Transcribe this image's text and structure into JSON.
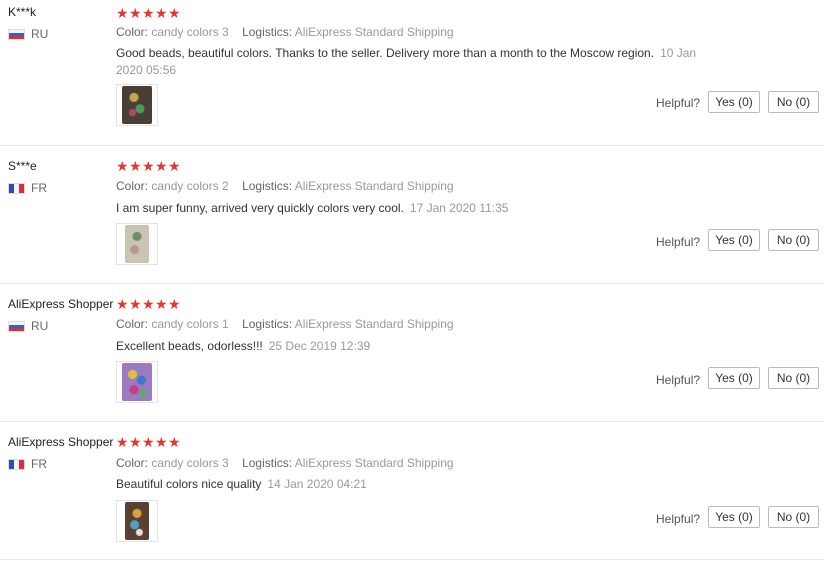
{
  "helpful_label": "Helpful?",
  "reviews": [
    {
      "user": "K***k",
      "country": "RU",
      "stars": 5,
      "color_label": "Color:",
      "color": "candy colors 3",
      "logistics_label": "Logistics:",
      "logistics": "AliExpress Standard Shipping",
      "text": "Good beads, beautiful colors. Thanks to the seller. Delivery more than a month to the Moscow region.",
      "date": "10 Jan 2020 05:56",
      "yes": "Yes (0)",
      "no": "No (0)"
    },
    {
      "user": "S***e",
      "country": "FR",
      "stars": 5,
      "color_label": "Color:",
      "color": "candy colors 2",
      "logistics_label": "Logistics:",
      "logistics": "AliExpress Standard Shipping",
      "text": "I am super funny, arrived very quickly colors very cool.",
      "date": "17 Jan 2020 11:35",
      "yes": "Yes (0)",
      "no": "No (0)"
    },
    {
      "user": "AliExpress Shopper",
      "country": "RU",
      "stars": 5,
      "color_label": "Color:",
      "color": "candy colors 1",
      "logistics_label": "Logistics:",
      "logistics": "AliExpress Standard Shipping",
      "text": "Excellent beads, odorless!!!",
      "date": "25 Dec 2019 12:39",
      "yes": "Yes (0)",
      "no": "No (0)"
    },
    {
      "user": "AliExpress Shopper",
      "country": "FR",
      "stars": 5,
      "color_label": "Color:",
      "color": "candy colors 3",
      "logistics_label": "Logistics:",
      "logistics": "AliExpress Standard Shipping",
      "text": "Beautiful colors nice quality",
      "date": "14 Jan 2020 04:21",
      "yes": "Yes (0)",
      "no": "No (0)"
    }
  ],
  "colors": {
    "star": "#e6362d",
    "flag_ru": [
      "#f4f4f4",
      "#3a5ec7",
      "#d7303a"
    ],
    "flag_fr": [
      "#2d4ea8",
      "#f4f4f4",
      "#d7303a"
    ]
  }
}
